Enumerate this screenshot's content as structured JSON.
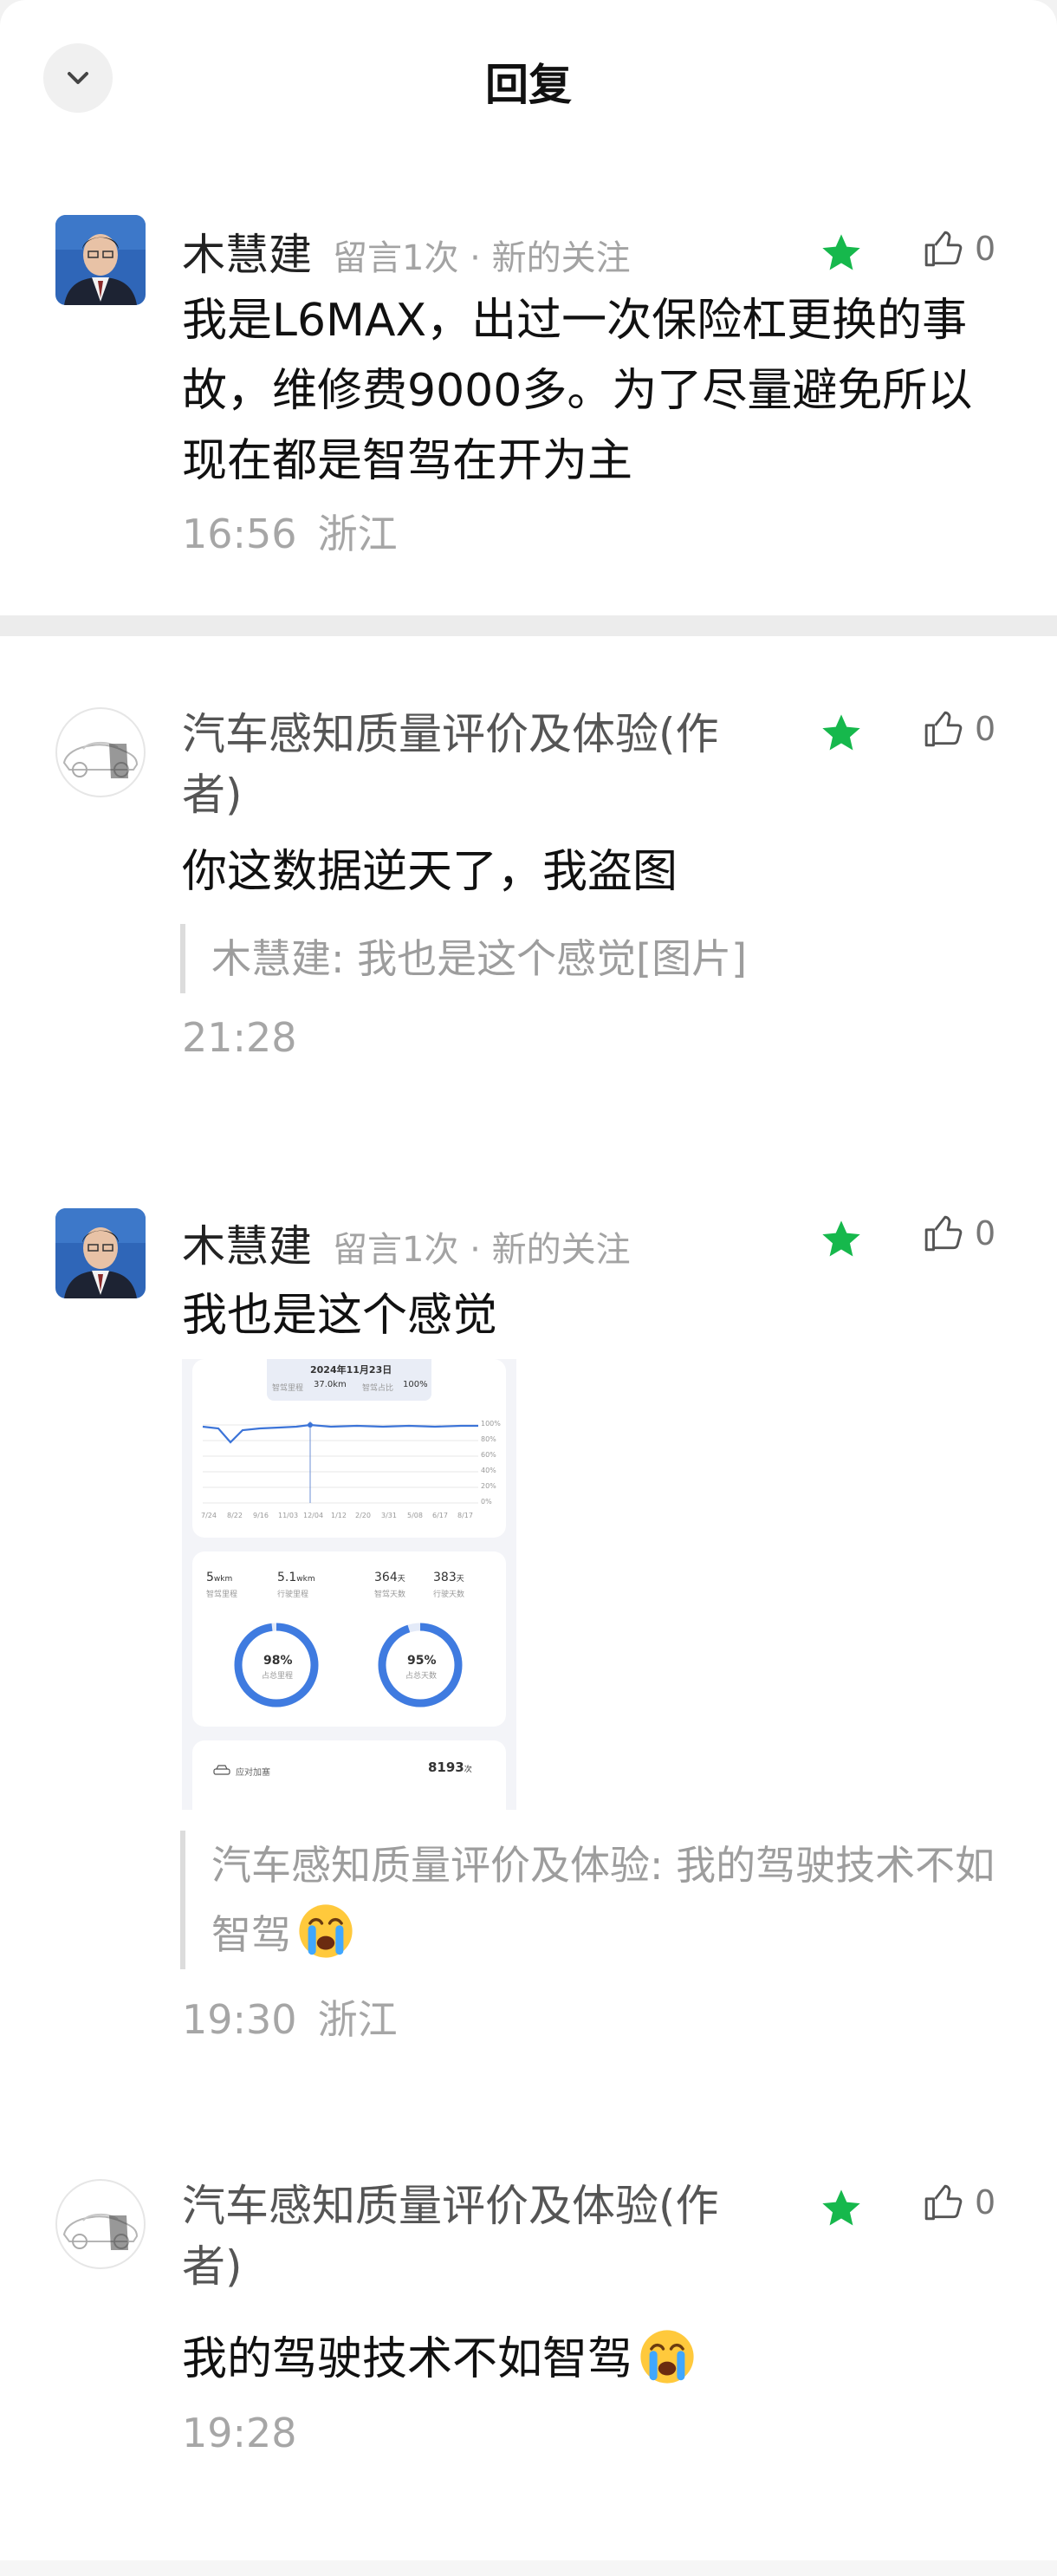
{
  "header": {
    "title": "回复"
  },
  "comments": [
    {
      "name": "木慧建",
      "meta": "留言1次 · 新的关注",
      "likes": "0",
      "text": "我是L6MAX，出过一次保险杠更换的事故，维修费9000多。为了尽量避免所以现在都是智驾在开为主",
      "time": "16:56",
      "location": "浙江"
    },
    {
      "name": "汽车感知质量评价及体验(作者)",
      "likes": "0",
      "text": "你这数据逆天了，我盗图",
      "quote": "木慧建: 我也是这个感觉[图片]",
      "time": "21:28"
    },
    {
      "name": "木慧建",
      "meta": "留言1次 · 新的关注",
      "likes": "0",
      "text": "我也是这个感觉",
      "quote": "汽车感知质量评价及体验: 我的驾驶技术不如智驾",
      "time": "19:30",
      "location": "浙江"
    },
    {
      "name": "汽车感知质量评价及体验(作者)",
      "likes": "0",
      "text": "我的驾驶技术不如智驾",
      "time": "19:28"
    }
  ],
  "screenshot": {
    "date": "2024年11月23日",
    "drive_label": "智驾里程",
    "drive_value": "37.0km",
    "ratio_label": "智驾占比",
    "ratio_value": "100%",
    "y_ticks": [
      "100%",
      "80%",
      "60%",
      "40%",
      "20%",
      "0%"
    ],
    "x_ticks": [
      "7/24",
      "8/22",
      "9/16",
      "11/03",
      "12/04",
      "1/12",
      "2/20",
      "3/31",
      "5/08",
      "6/17",
      "8/17"
    ],
    "stat1_value": "5",
    "stat1_unit": "wkm",
    "stat1_label": "智驾里程",
    "stat2_value": "5.1",
    "stat2_unit": "wkm",
    "stat2_label": "行驶里程",
    "stat3_value": "364",
    "stat3_unit": "天",
    "stat3_label": "智驾天数",
    "stat4_value": "383",
    "stat4_unit": "天",
    "stat4_label": "行驶天数",
    "ring1_value": "98%",
    "ring1_fraction": 0.98,
    "ring1_label": "占总里程",
    "ring2_value": "95%",
    "ring2_fraction": 0.95,
    "ring2_label": "占总天数",
    "row_label": "应对加塞",
    "row_value": "8193",
    "row_unit": "次"
  }
}
